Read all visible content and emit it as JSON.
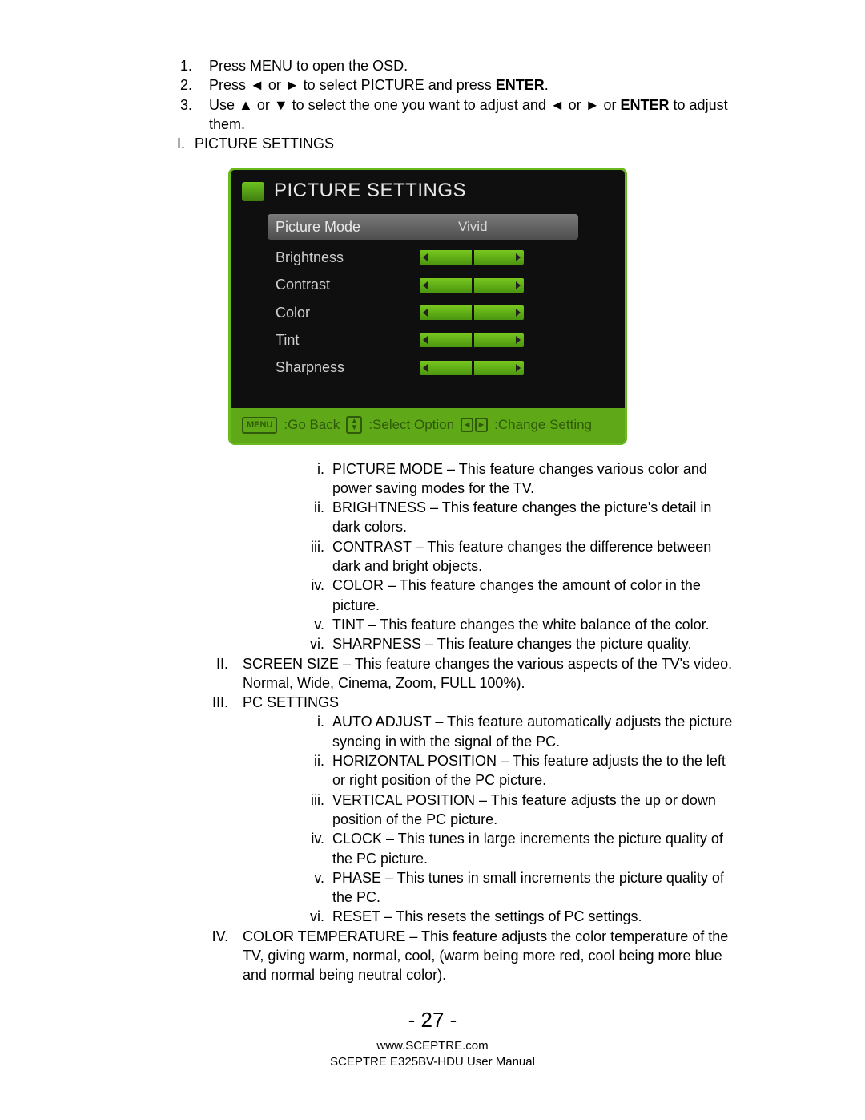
{
  "steps": {
    "s1": "Press MENU to open the OSD.",
    "s2_pre": "Press ◄ or ► to select PICTURE and press ",
    "s2_bold": "ENTER",
    "s2_post": ".",
    "s3_pre": "Use ▲ or ▼ to select the one you want to adjust and ◄ or ► or ",
    "s3_bold": "ENTER",
    "s3_post": " to adjust them."
  },
  "sec_I": "PICTURE SETTINGS",
  "osd": {
    "title": "PICTURE SETTINGS",
    "rows": {
      "mode_label": "Picture Mode",
      "mode_value": "Vivid",
      "brightness": "Brightness",
      "contrast": "Contrast",
      "color": "Color",
      "tint": "Tint",
      "sharpness": "Sharpness"
    },
    "footer": {
      "menu_icon": "MENU",
      "go_back": ":Go Back",
      "select": ":Select Option",
      "change": ":Change Setting"
    }
  },
  "picture_items": {
    "i": "PICTURE MODE – This feature changes various color and power saving modes for the TV.",
    "ii": "BRIGHTNESS – This feature changes the picture's detail in dark colors.",
    "iii": "CONTRAST – This feature changes the difference between dark and bright objects.",
    "iv": "COLOR – This feature changes the amount of color in the picture.",
    "v": "TINT – This feature changes the white balance of the color.",
    "vi": "SHARPNESS – This feature changes the picture quality."
  },
  "sec_II": "SCREEN SIZE – This feature changes the various aspects of the TV's video.  Normal, Wide, Cinema, Zoom, FULL 100%).",
  "sec_III_label": "PC SETTINGS",
  "pc_items": {
    "i": "AUTO ADJUST – This feature automatically adjusts the picture syncing in with the signal of the PC.",
    "ii": "HORIZONTAL POSITION – This feature adjusts the to the left or right position of the PC picture.",
    "iii": "VERTICAL POSITION – This feature adjusts the up or down position of the PC picture.",
    "iv": "CLOCK – This tunes in large increments the picture quality of the PC picture.",
    "v": "PHASE – This tunes in small increments the picture quality of the PC.",
    "vi": "RESET – This resets the settings of PC settings."
  },
  "sec_IV": "COLOR TEMPERATURE – This feature adjusts the color temperature of the TV, giving warm, normal, cool, (warm being more red, cool being more blue and normal being neutral color).",
  "footer": {
    "page": "- 27 -",
    "url": "www.SCEPTRE.com",
    "manual": "SCEPTRE E325BV-HDU User Manual"
  }
}
